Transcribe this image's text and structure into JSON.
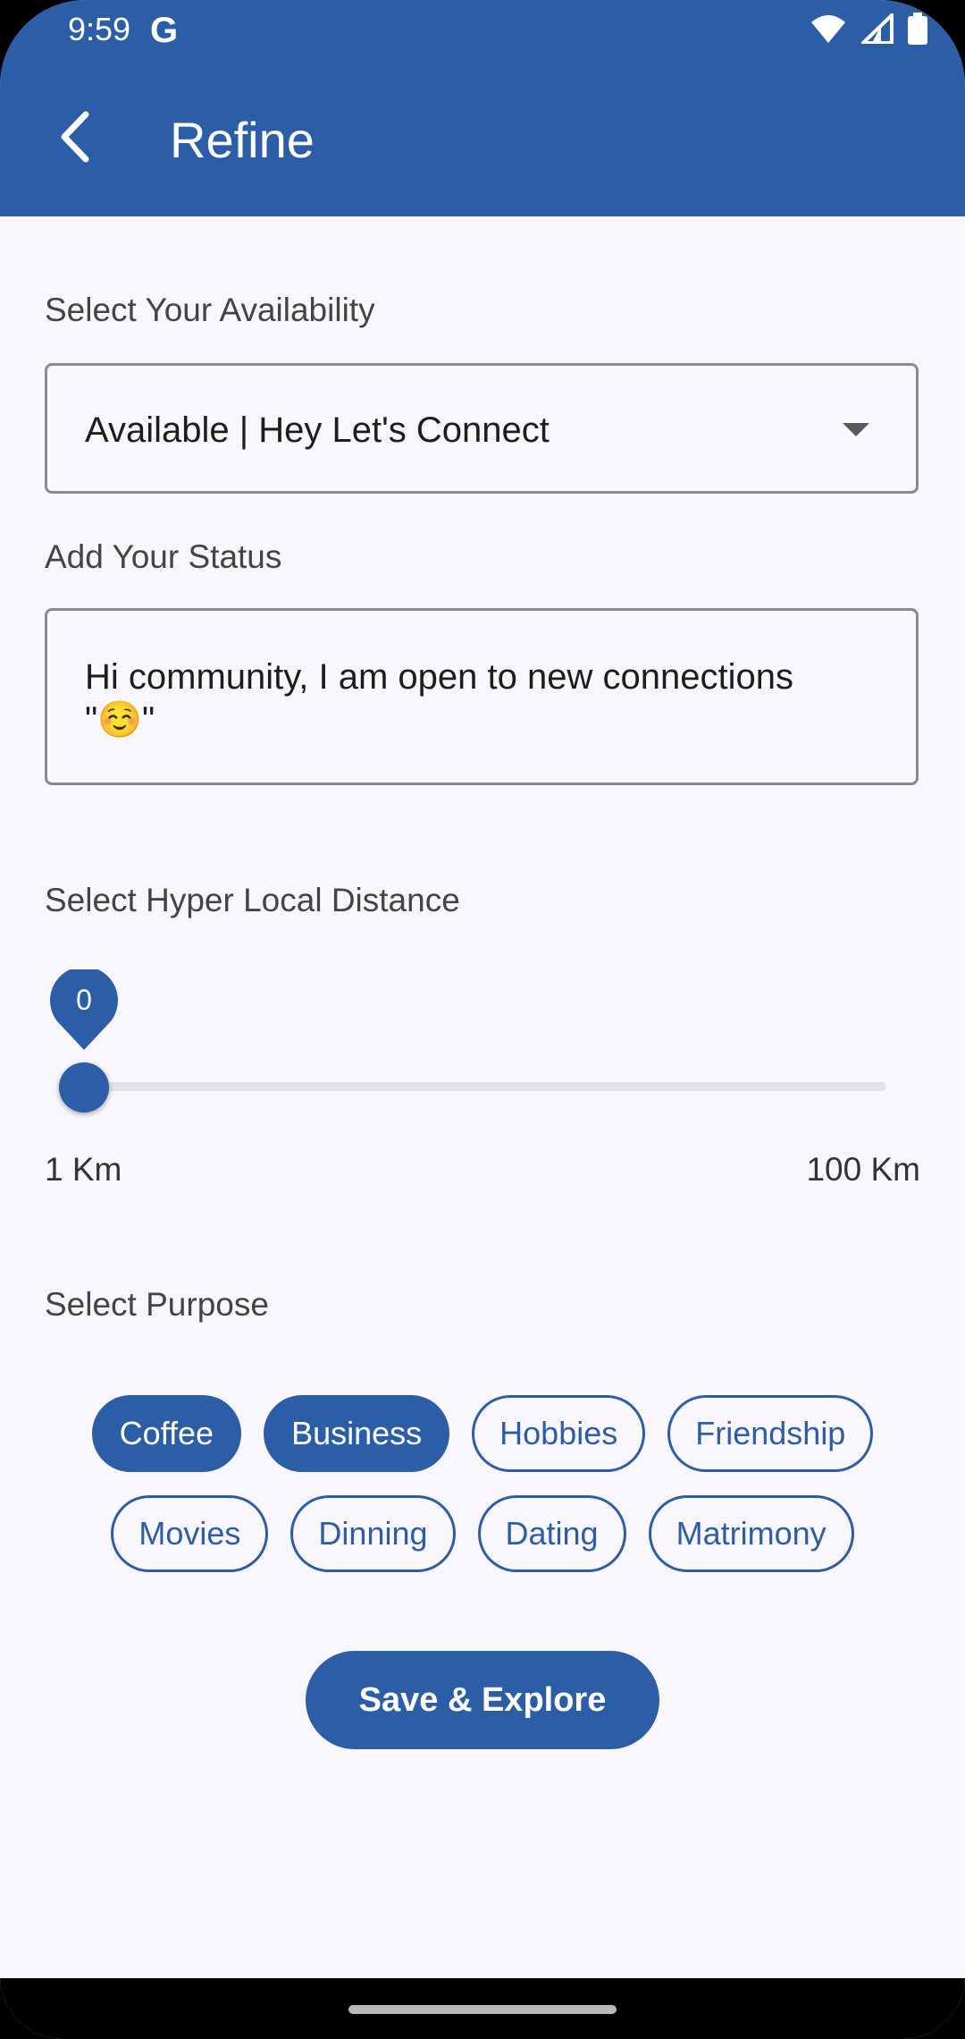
{
  "status_bar": {
    "time": "9:59",
    "g_logo": "G"
  },
  "app_bar": {
    "title": "Refine",
    "back_icon": "back-arrow-icon"
  },
  "availability": {
    "label": "Select Your Availability",
    "value": "Available | Hey Let's Connect"
  },
  "status": {
    "label": "Add Your Status",
    "value": "Hi community, I am open to new connections \"☺️\""
  },
  "distance": {
    "label": "Select Hyper Local Distance",
    "value": "0",
    "min_label": "1 Km",
    "max_label": "100 Km"
  },
  "purpose": {
    "label": "Select Purpose",
    "row1": [
      {
        "label": "Coffee",
        "selected": true
      },
      {
        "label": "Business",
        "selected": true
      },
      {
        "label": "Hobbies",
        "selected": false
      },
      {
        "label": "Friendship",
        "selected": false
      }
    ],
    "row2": [
      {
        "label": "Movies",
        "selected": false
      },
      {
        "label": "Dinning",
        "selected": false
      },
      {
        "label": "Dating",
        "selected": false
      },
      {
        "label": "Matrimony",
        "selected": false
      }
    ]
  },
  "save_button": "Save & Explore",
  "colors": {
    "primary": "#2c5ea8",
    "background": "#f9f7fb"
  }
}
